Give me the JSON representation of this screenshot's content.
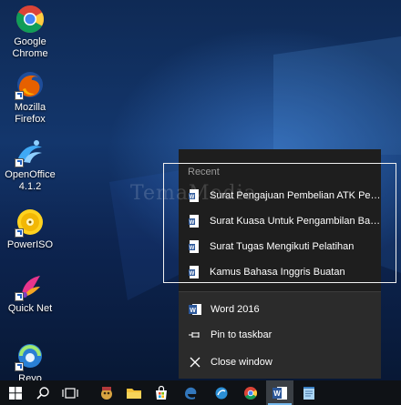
{
  "desktop": {
    "icons": [
      {
        "label": "Google Chrome",
        "icon": "chrome-icon"
      },
      {
        "label": "Mozilla Firefox",
        "icon": "firefox-icon"
      },
      {
        "label": "OpenOffice 4.1.2",
        "icon": "openoffice-icon"
      },
      {
        "label": "PowerISO",
        "icon": "poweriso-icon"
      },
      {
        "label": "Quick Net",
        "icon": "quicknet-icon"
      },
      {
        "label": "Revo",
        "icon": "revo-icon"
      }
    ]
  },
  "watermark": "TemaMedia",
  "jumplist": {
    "recent_header": "Recent",
    "recent_items": [
      "Surat Pengajuan Pembelian ATK Periode",
      "Surat Kuasa Untuk Pengambilan Barang",
      "Surat Tugas Mengikuti Pelatihan",
      "Kamus Bahasa Inggris Buatan"
    ],
    "app_name": "Word 2016",
    "pin_label": "Pin to taskbar",
    "close_label": "Close window"
  },
  "taskbar": {
    "buttons": [
      "windows-start-icon",
      "search-icon",
      "task-view-icon",
      "app-icon",
      "file-explorer-icon",
      "store-icon",
      "edge-icon",
      "firefox-icon",
      "chrome-icon",
      "word-icon",
      "notepad-icon"
    ],
    "active": "word-icon"
  },
  "colors": {
    "word_blue": "#2b579a",
    "jumplist_bg": "#2b2b2b",
    "recent_bg": "#1e1e1e",
    "taskbar_bg": "#0f1216"
  }
}
